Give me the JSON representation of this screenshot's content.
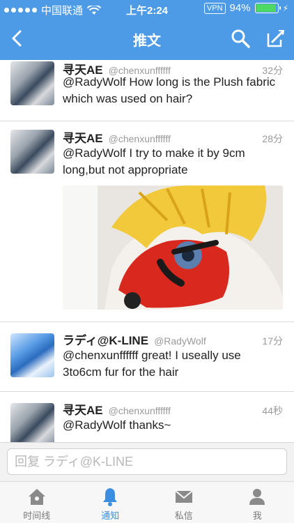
{
  "status": {
    "carrier": "中国联通",
    "time": "上午2:24",
    "vpn": "VPN",
    "battery": "94%",
    "battery_level": 0.94
  },
  "nav": {
    "title": "推文"
  },
  "tweets": [
    {
      "name": "寻天AE",
      "handle": "@chenxunffffff",
      "ago": "32分",
      "text": "@RadyWolf How long is the Plush fabric which was used on hair?"
    },
    {
      "name": "寻天AE",
      "handle": "@chenxunffffff",
      "ago": "28分",
      "text": "@RadyWolf I try to make it by 9cm long,but not appropriate"
    },
    {
      "name": "ラディ@K-LINE",
      "handle": "@RadyWolf",
      "ago": "17分",
      "text": "@chenxunffffff great! I useally use 3to6cm fur for the hair"
    },
    {
      "name": "寻天AE",
      "handle": "@chenxunffffff",
      "ago": "44秒",
      "text": "@RadyWolf thanks~"
    }
  ],
  "reply": {
    "placeholder": "回复 ラディ@K-LINE"
  },
  "tabs": [
    {
      "label": "时间线"
    },
    {
      "label": "通知"
    },
    {
      "label": "私信"
    },
    {
      "label": "我"
    }
  ],
  "colors": {
    "brand": "#4d9be6",
    "active_tab": "#3b8ee0"
  }
}
